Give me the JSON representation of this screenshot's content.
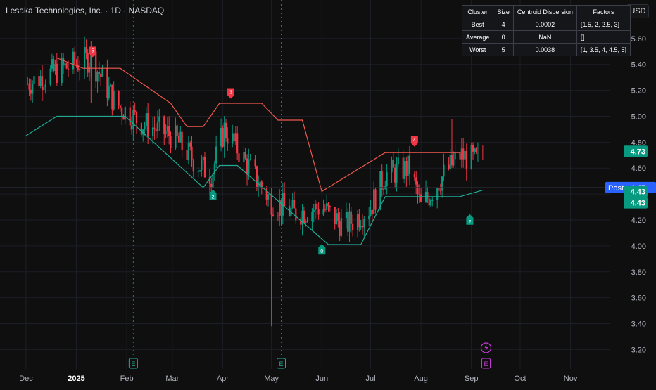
{
  "header": {
    "title": "Lesaka Technologies, Inc. · 1D · NASDAQ",
    "currency": "USD"
  },
  "table": {
    "headers": [
      "Cluster",
      "Size",
      "Centroid Dispersion",
      "Factors"
    ],
    "rows": [
      [
        "Best",
        "4",
        "0.0002",
        "[1.5, 2, 2.5, 3]"
      ],
      [
        "Average",
        "0",
        "NaN",
        "[]"
      ],
      [
        "Worst",
        "5",
        "0.0038",
        "[1, 3.5, 4, 4.5, 5]"
      ]
    ]
  },
  "colors": {
    "background": "#0f0f0f",
    "up": "#089981",
    "down": "#f23645",
    "bear_trail": "#f0584e",
    "bull_trail": "#22ab94",
    "earnings": "#22ab94",
    "dividend": "#c23bd4",
    "post_badge": "#2962ff",
    "grid": "#1c1f26"
  },
  "chart_data": {
    "type": "candlestick",
    "symbol": "Lesaka Technologies, Inc.",
    "interval": "1D",
    "exchange": "NASDAQ",
    "ylim": [
      3.15,
      5.7
    ],
    "y_ticks": [
      "5.60",
      "5.40",
      "5.20",
      "5.00",
      "4.80",
      "4.60",
      "4.40",
      "4.20",
      "4.00",
      "3.80",
      "3.60",
      "3.40",
      "3.20"
    ],
    "x_ticks": [
      "Dec",
      "2025",
      "Feb",
      "Mar",
      "Apr",
      "May",
      "Jun",
      "Jul",
      "Aug",
      "Sep",
      "Oct",
      "Nov"
    ],
    "x_tick_dates": [
      "2024-12-01",
      "2025-01-01",
      "2025-02-01",
      "2025-03-01",
      "2025-04-01",
      "2025-05-01",
      "2025-06-01",
      "2025-07-01",
      "2025-08-01",
      "2025-09-01",
      "2025-10-01",
      "2025-11-01"
    ],
    "x_range": [
      "2024-12-01",
      "2025-11-20"
    ],
    "price_labels": [
      {
        "label": "",
        "value": "4.73",
        "price": 4.73,
        "kind": "last"
      },
      {
        "label": "Post",
        "value": "4.45",
        "price": 4.45,
        "kind": "post"
      },
      {
        "label": "",
        "value": "4.43",
        "price": 4.43,
        "kind": "trail"
      },
      {
        "label": "",
        "value": "4.43",
        "price": 4.43,
        "kind": "trail"
      }
    ],
    "anchors": [
      {
        "date": "2024-12-01",
        "price": 5.25
      },
      {
        "date": "2024-12-20",
        "price": 5.35
      },
      {
        "date": "2025-01-10",
        "price": 5.45
      },
      {
        "date": "2025-01-25",
        "price": 5.1
      },
      {
        "date": "2025-02-10",
        "price": 4.95
      },
      {
        "date": "2025-03-01",
        "price": 4.85
      },
      {
        "date": "2025-03-15",
        "price": 4.65
      },
      {
        "date": "2025-03-25",
        "price": 4.55
      },
      {
        "date": "2025-04-02",
        "price": 4.9
      },
      {
        "date": "2025-04-10",
        "price": 4.75
      },
      {
        "date": "2025-04-25",
        "price": 4.45
      },
      {
        "date": "2025-05-01",
        "price": 4.35
      },
      {
        "date": "2025-05-15",
        "price": 4.25
      },
      {
        "date": "2025-06-01",
        "price": 4.3
      },
      {
        "date": "2025-06-15",
        "price": 4.15
      },
      {
        "date": "2025-07-01",
        "price": 4.3
      },
      {
        "date": "2025-07-10",
        "price": 4.55
      },
      {
        "date": "2025-07-25",
        "price": 4.6
      },
      {
        "date": "2025-08-01",
        "price": 4.3
      },
      {
        "date": "2025-08-15",
        "price": 4.55
      },
      {
        "date": "2025-08-25",
        "price": 4.7
      },
      {
        "date": "2025-09-05",
        "price": 4.65
      },
      {
        "date": "2025-09-08",
        "price": 4.73
      }
    ],
    "wicks": [
      {
        "date": "2025-05-01",
        "high": 4.35,
        "low": 3.38
      },
      {
        "date": "2025-01-10",
        "high": 5.58,
        "low": 5.1
      },
      {
        "date": "2025-08-20",
        "high": 4.98,
        "low": 4.6
      }
    ],
    "bear_trail": [
      {
        "date": "2024-12-20",
        "price": 5.45
      },
      {
        "date": "2025-01-05",
        "price": 5.37
      },
      {
        "date": "2025-01-28",
        "price": 5.37
      },
      {
        "date": "2025-02-28",
        "price": 5.1
      },
      {
        "date": "2025-03-10",
        "price": 4.92
      },
      {
        "date": "2025-03-20",
        "price": 4.92
      },
      {
        "date": "2025-03-30",
        "price": 5.1
      },
      {
        "date": "2025-04-25",
        "price": 5.1
      },
      {
        "date": "2025-05-05",
        "price": 4.97
      },
      {
        "date": "2025-05-20",
        "price": 4.97
      },
      {
        "date": "2025-06-01",
        "price": 4.42
      },
      {
        "date": "2025-07-10",
        "price": 4.72
      },
      {
        "date": "2025-08-25",
        "price": 4.72
      }
    ],
    "bull_trail": [
      {
        "date": "2024-12-01",
        "price": 4.85
      },
      {
        "date": "2024-12-20",
        "price": 5.0
      },
      {
        "date": "2025-01-31",
        "price": 5.0
      },
      {
        "date": "2025-03-20",
        "price": 4.45
      },
      {
        "date": "2025-03-30",
        "price": 4.62
      },
      {
        "date": "2025-04-10",
        "price": 4.62
      },
      {
        "date": "2025-06-05",
        "price": 4.01
      },
      {
        "date": "2025-06-25",
        "price": 4.01
      },
      {
        "date": "2025-07-10",
        "price": 4.38
      },
      {
        "date": "2025-07-28",
        "price": 4.38
      },
      {
        "date": "2025-08-25",
        "price": 4.38
      },
      {
        "date": "2025-09-08",
        "price": 4.43
      }
    ],
    "signals": [
      {
        "type": "bear",
        "label": "5",
        "date": "2025-01-11",
        "price": 5.45
      },
      {
        "type": "bear",
        "label": "3",
        "date": "2025-04-06",
        "price": 5.13
      },
      {
        "type": "bear",
        "label": "4",
        "date": "2025-07-28",
        "price": 4.76
      },
      {
        "type": "bull",
        "label": "2",
        "date": "2025-03-26",
        "price": 4.44
      },
      {
        "type": "bull",
        "label": "0",
        "date": "2025-06-01",
        "price": 4.02
      },
      {
        "type": "bull",
        "label": "2",
        "date": "2025-08-31",
        "price": 4.25
      }
    ],
    "events": [
      {
        "type": "earnings",
        "label": "E",
        "date": "2025-02-05"
      },
      {
        "type": "earnings",
        "label": "E",
        "date": "2025-05-07"
      },
      {
        "type": "dividend",
        "label": "E",
        "date": "2025-09-10"
      }
    ]
  }
}
